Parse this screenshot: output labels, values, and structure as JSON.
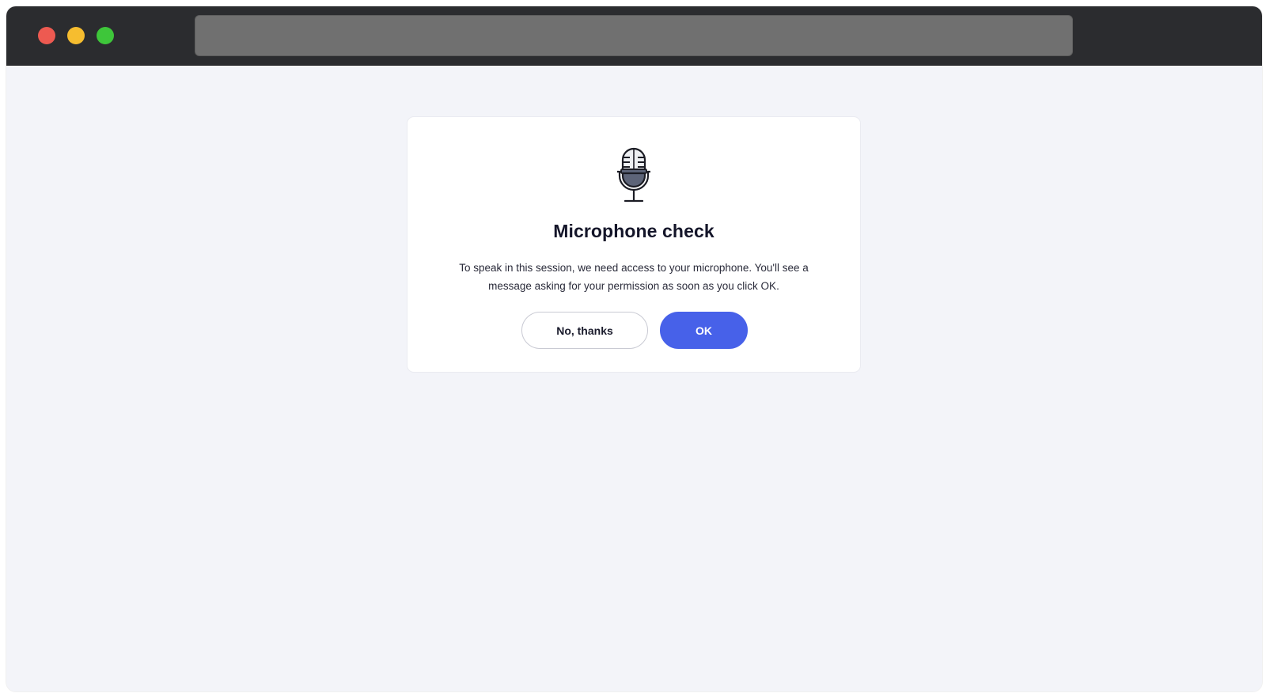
{
  "dialog": {
    "icon": "microphone-icon",
    "title": "Microphone check",
    "message": "To speak in this session, we need access to your microphone. You'll see a message asking for your permission as soon as you click OK.",
    "secondary_label": "No, thanks",
    "primary_label": "OK"
  },
  "colors": {
    "background": "#f3f4f9",
    "titlebar": "#2b2c2f",
    "address_bar": "#707070",
    "primary": "#4761e9",
    "close": "#ed5a51",
    "minimize": "#f6bd2f",
    "maximize": "#3ec63a"
  }
}
